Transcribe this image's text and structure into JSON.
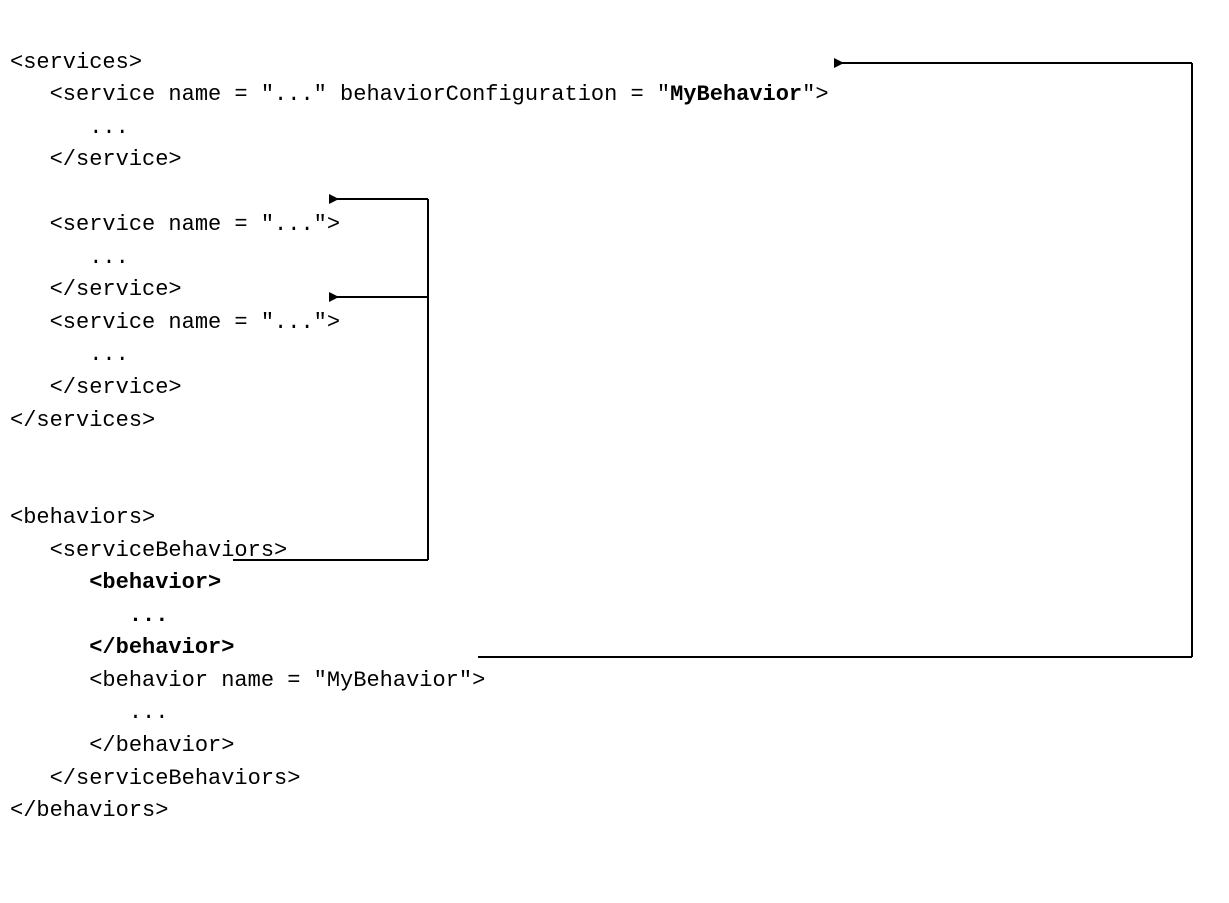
{
  "code": {
    "l01": "<services>",
    "l02a": "   <service name = \"...\" behaviorConfiguration = \"",
    "l02b": "MyBehavior",
    "l02c": "\">",
    "l03": "      ...",
    "l04": "   </service>",
    "l05": "",
    "l06": "   <service name = \"...\">",
    "l07": "      ...",
    "l08": "   </service>",
    "l09": "   <service name = \"...\">",
    "l10": "      ...",
    "l11": "   </service>",
    "l12": "</services>",
    "l13": "",
    "l14": "",
    "l15": "<behaviors>",
    "l16": "   <serviceBehaviors>",
    "l17": "      <behavior>",
    "l18": "         ...",
    "l19": "      </behavior>",
    "l20": "      <behavior name = \"MyBehavior\">",
    "l21": "         ...",
    "l22": "      </behavior>",
    "l23": "   </serviceBehaviors>",
    "l24": "</behaviors>"
  },
  "arrows": {
    "defaultBehavior": {
      "from": "behavior-unnamed",
      "to": [
        "service2",
        "service3"
      ]
    },
    "namedBehavior": {
      "from": "behavior-MyBehavior",
      "to": [
        "service1-MyBehavior-ref"
      ]
    }
  }
}
